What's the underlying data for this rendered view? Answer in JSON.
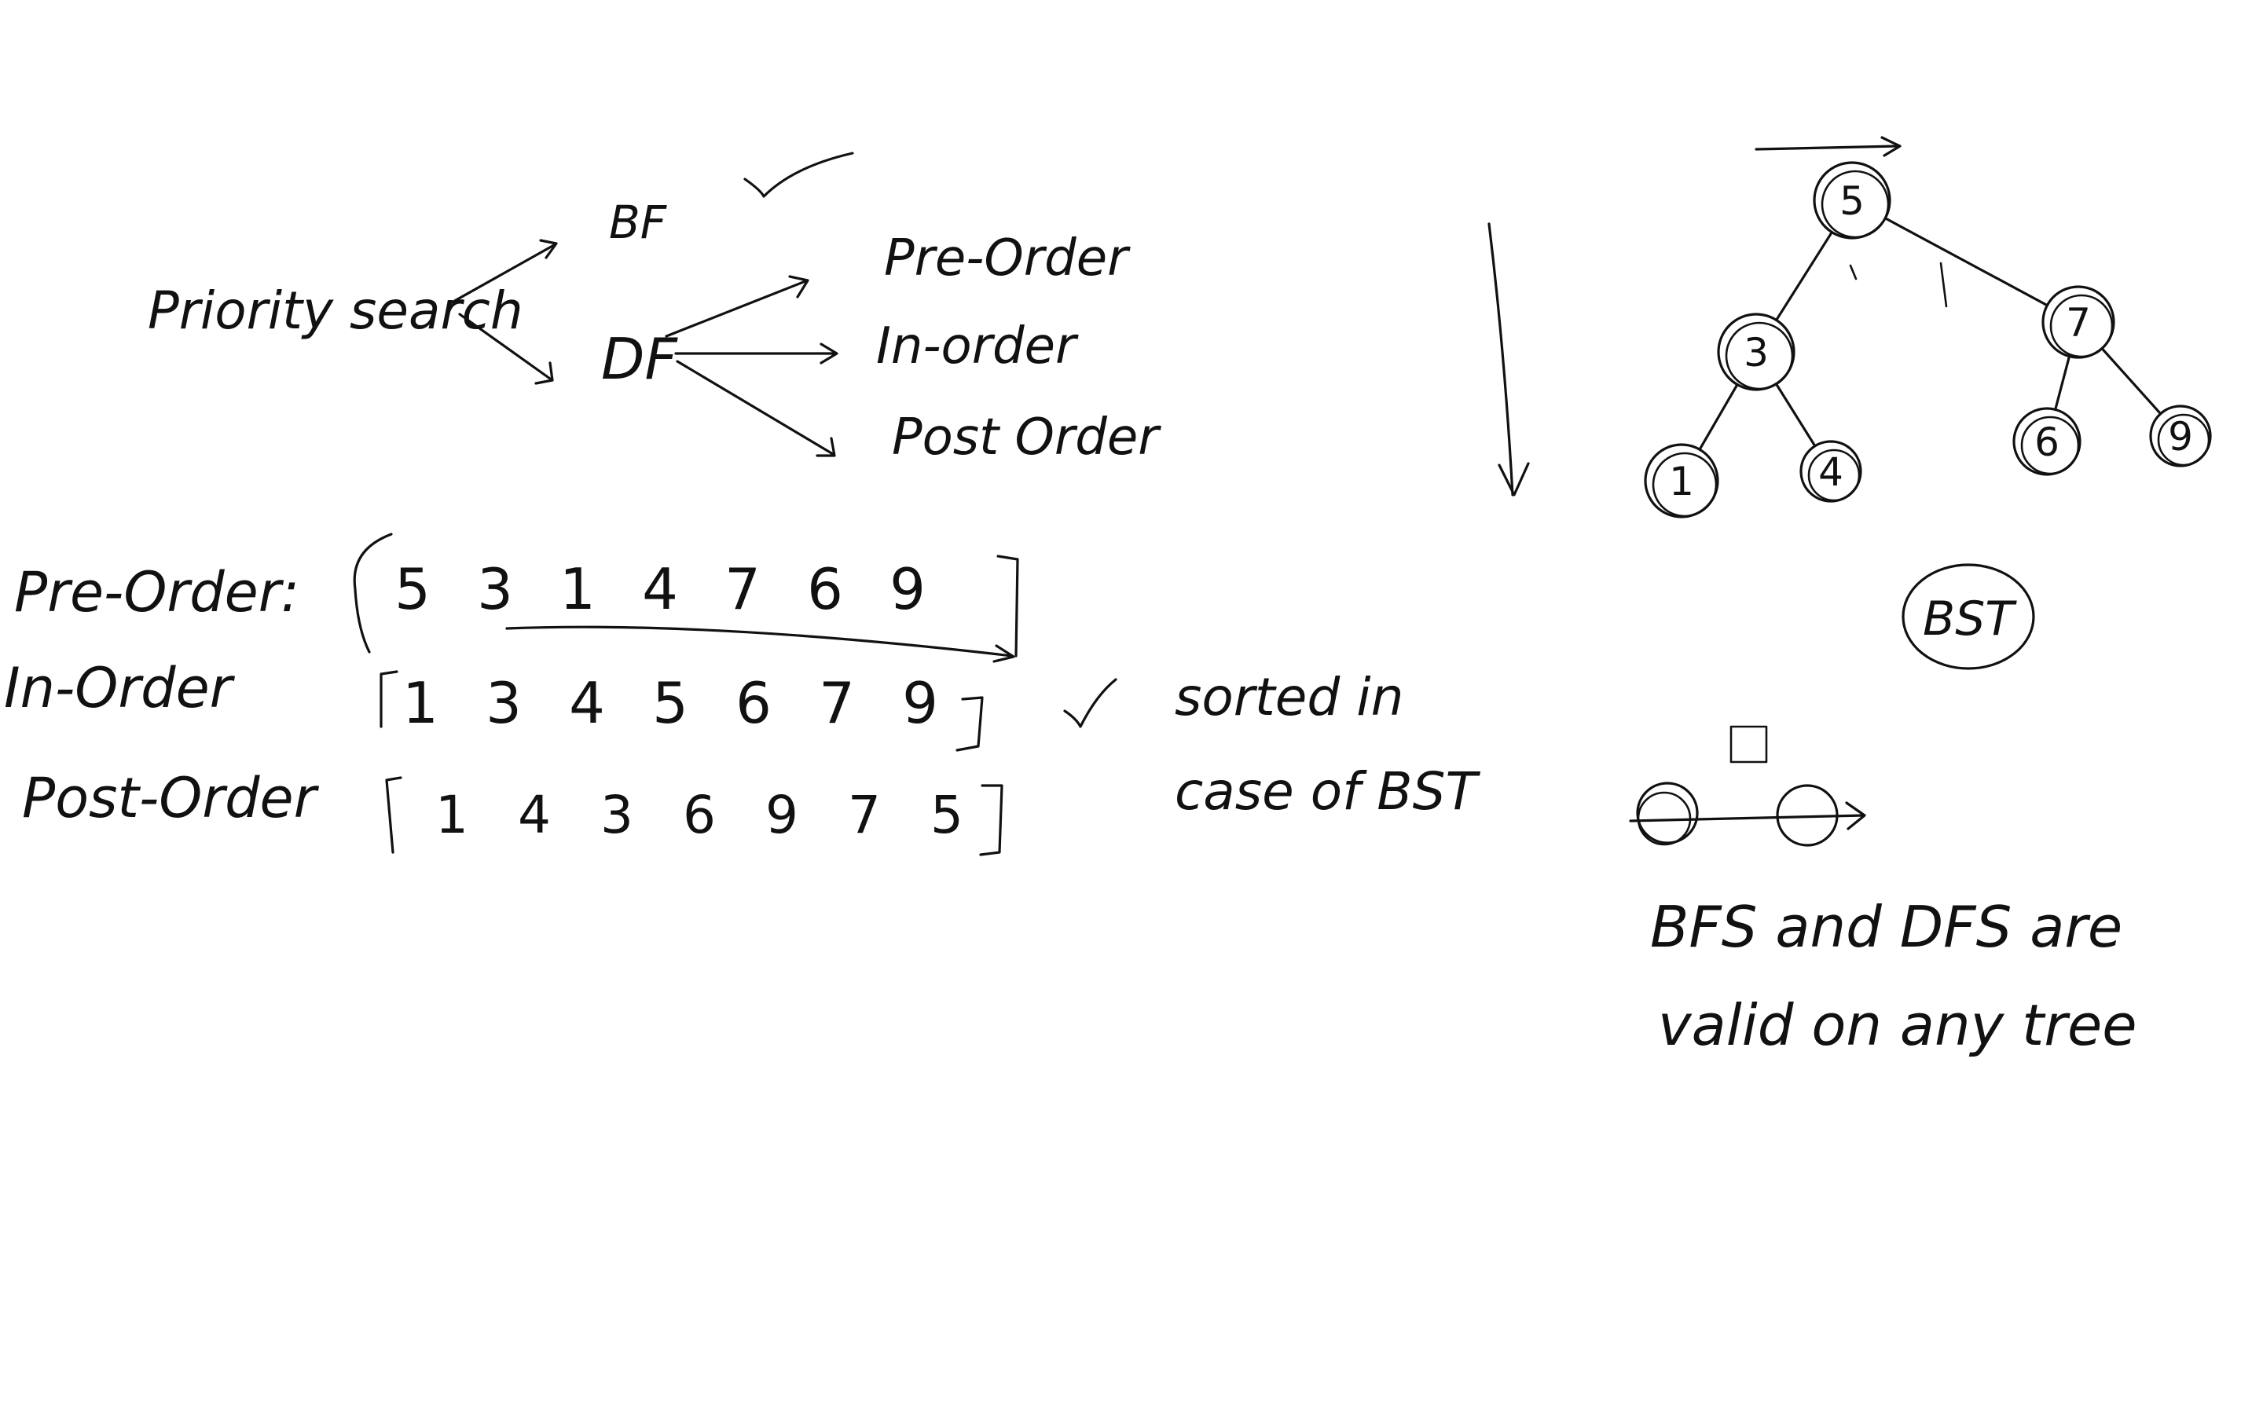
{
  "traversal": {
    "root_label": "Priority search",
    "bf_label": "BF",
    "df_label": "DF",
    "orders": [
      "Pre-Order",
      "In-order",
      "Post Order"
    ]
  },
  "sequences": {
    "preorder": {
      "label": "Pre-Order:",
      "values": [
        "5",
        "3",
        "1",
        "4",
        "7",
        "6",
        "9"
      ]
    },
    "inorder": {
      "label": "In-Order",
      "values": [
        "1",
        "3",
        "4",
        "5",
        "6",
        "7",
        "9"
      ]
    },
    "postorder": {
      "label": "Post-Order",
      "values": [
        "1",
        "4",
        "3",
        "6",
        "9",
        "7",
        "5"
      ]
    }
  },
  "notes": {
    "sorted_line1": "sorted in",
    "sorted_line2": "case of BST",
    "bst_label": "BST",
    "bottom_line1": "BFS and DFS are",
    "bottom_line2": "valid on any tree"
  },
  "tree": {
    "nodes": [
      "5",
      "3",
      "7",
      "1",
      "4",
      "6",
      "9"
    ]
  },
  "ink_color": "#111111"
}
